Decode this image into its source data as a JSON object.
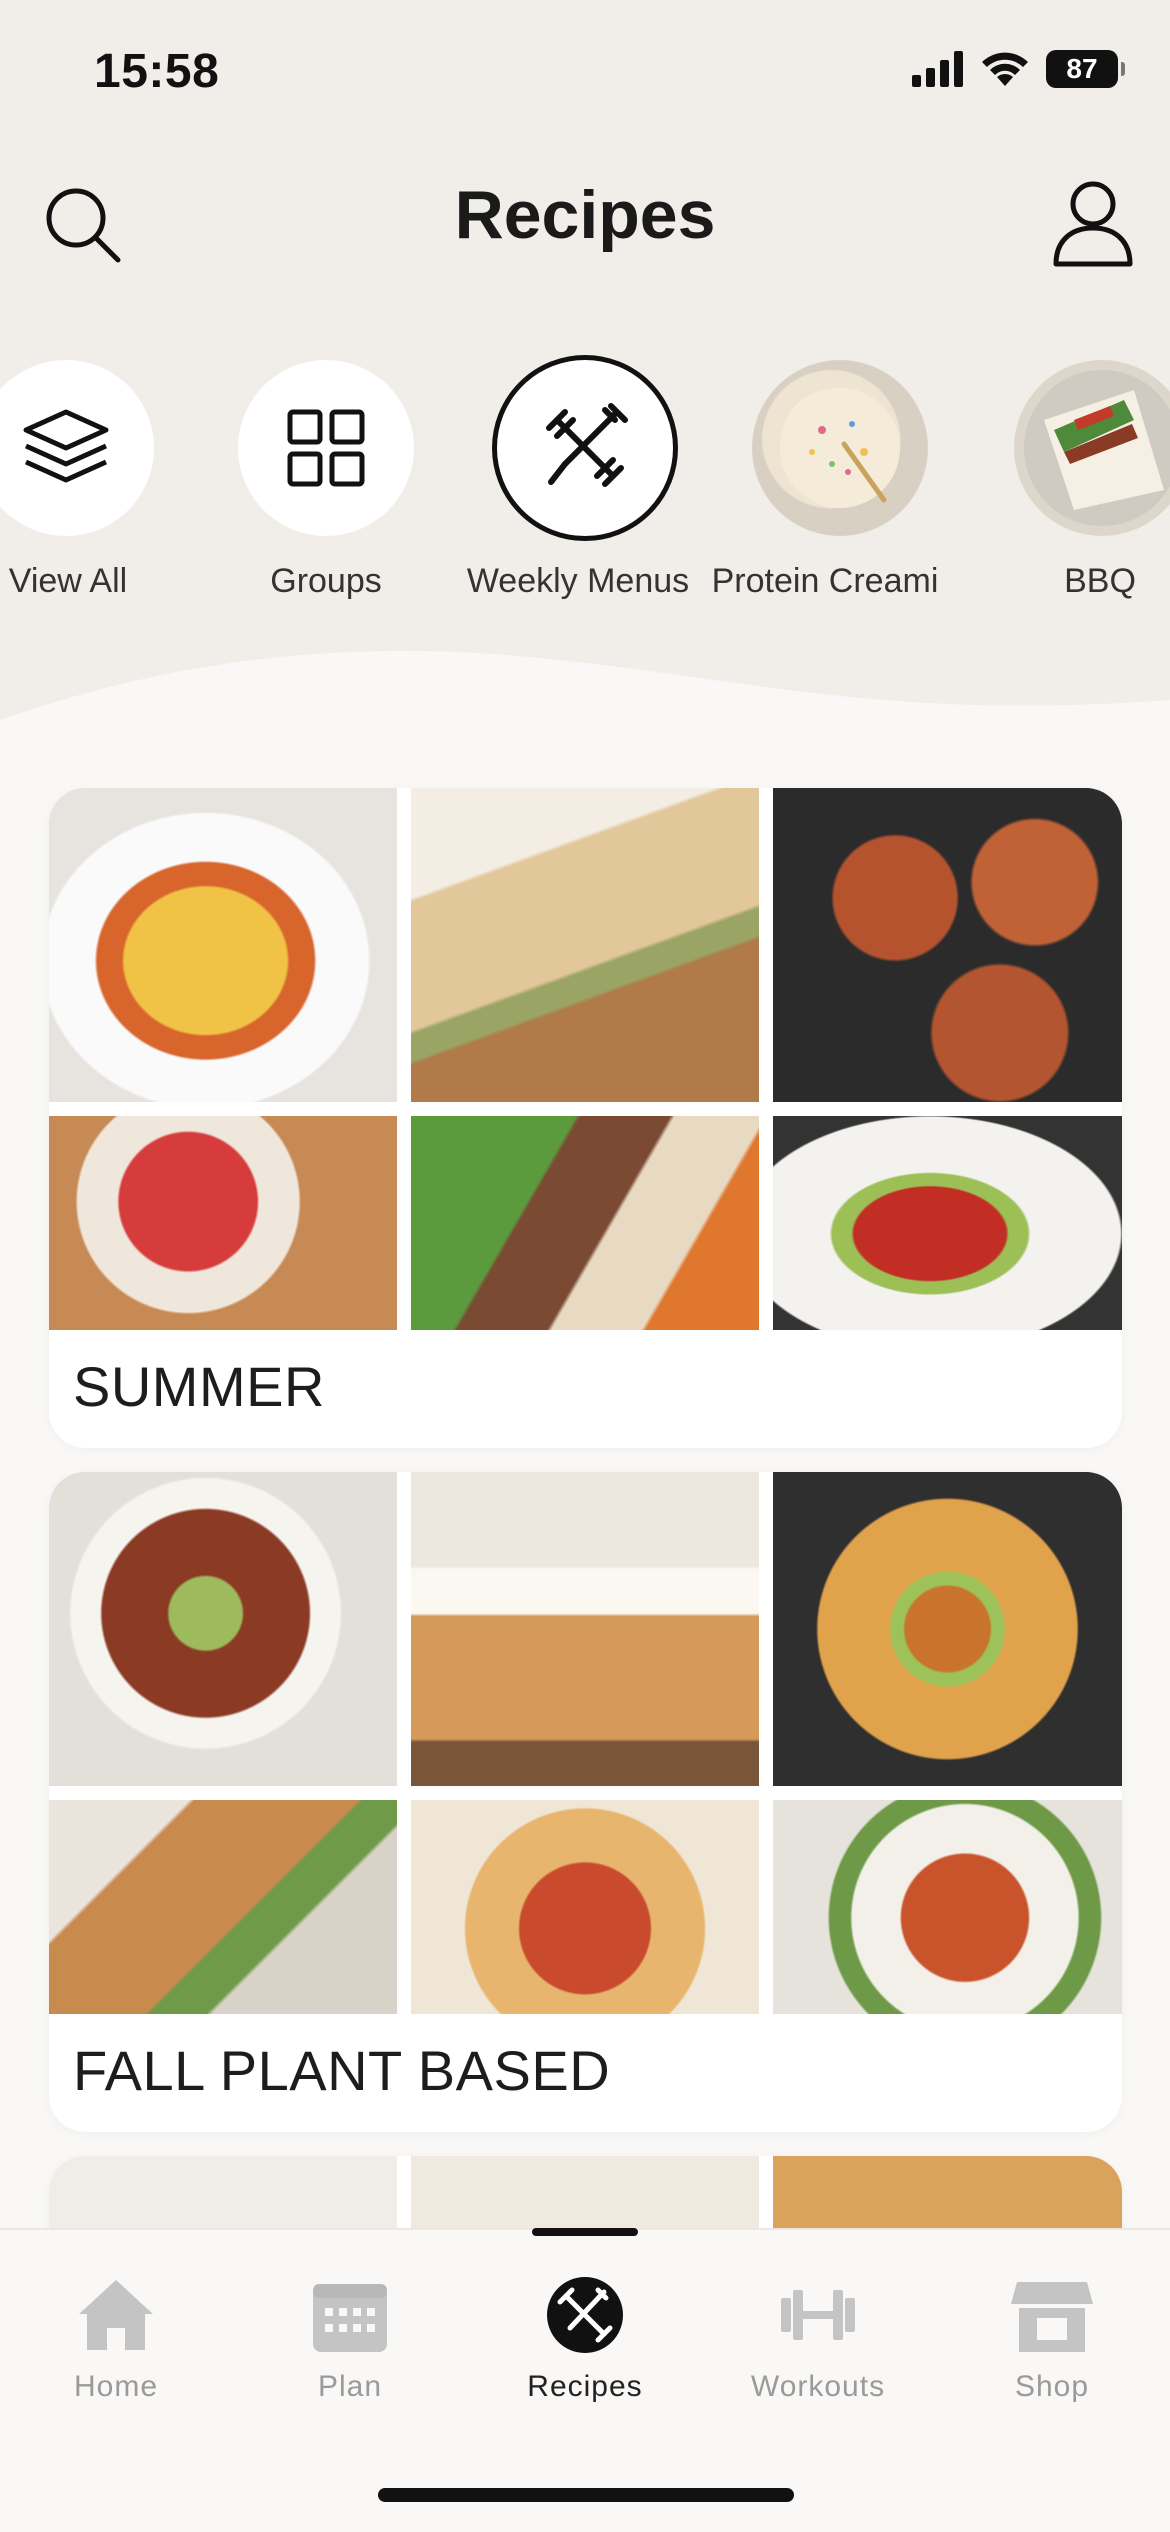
{
  "status_bar": {
    "time": "15:58",
    "battery": "87"
  },
  "header": {
    "title": "Recipes",
    "search_icon": "search-icon",
    "profile_icon": "profile-icon"
  },
  "categories": [
    {
      "label": "View All",
      "icon": "layers-icon",
      "active": false
    },
    {
      "label": "Groups",
      "icon": "grid-icon",
      "active": false
    },
    {
      "label": "Weekly Menus",
      "icon": "dumbbell-fork-icon",
      "active": true
    },
    {
      "label": "Protein Creami",
      "icon": "protein-creami-image",
      "active": false
    },
    {
      "label": "BBQ",
      "icon": "bbq-wrap-image",
      "active": false
    }
  ],
  "cards": [
    {
      "title": "SUMMER"
    },
    {
      "title": "FALL PLANT BASED"
    }
  ],
  "bottom_nav": [
    {
      "label": "Home",
      "icon": "home-icon"
    },
    {
      "label": "Plan",
      "icon": "calendar-icon"
    },
    {
      "label": "Recipes",
      "icon": "recipes-icon",
      "active": true
    },
    {
      "label": "Workouts",
      "icon": "barbell-icon"
    },
    {
      "label": "Shop",
      "icon": "shop-icon"
    }
  ],
  "colors": {
    "background": "#f1ede8",
    "surface": "#ffffff",
    "text": "#1c1c1c",
    "inactive": "#c4c4c4"
  }
}
